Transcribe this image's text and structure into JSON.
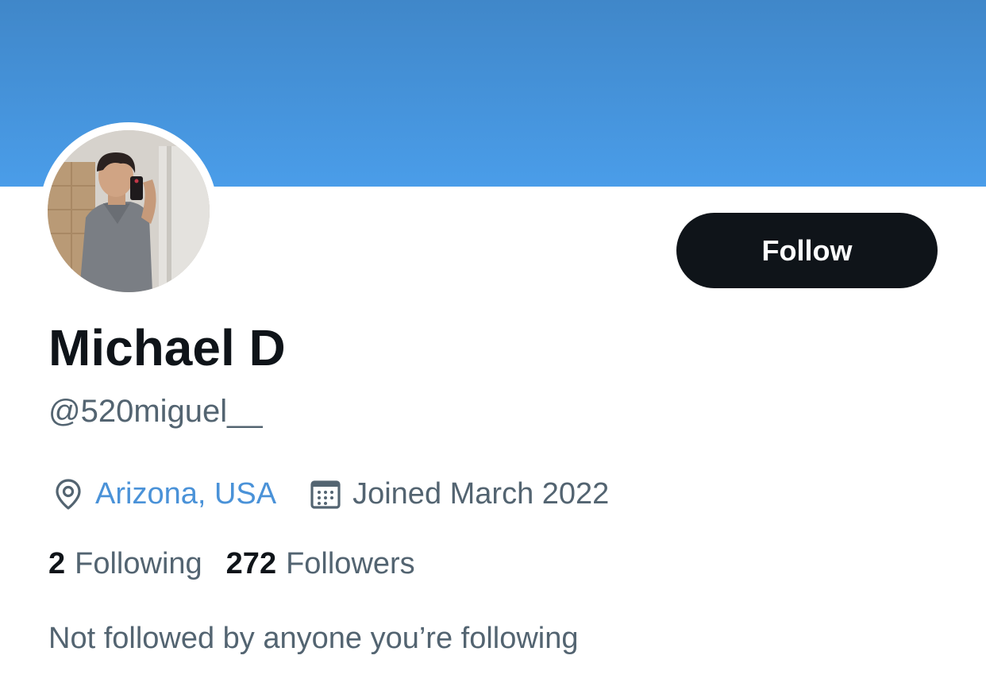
{
  "profile": {
    "banner_color": "#4a9de9",
    "avatar_alt": "profile photo",
    "display_name": "Michael D",
    "handle": "@520miguel__",
    "location": "Arizona, USA",
    "joined": "Joined March 2022",
    "location_icon": "location-pin-icon",
    "joined_icon": "calendar-icon"
  },
  "actions": {
    "follow_label": "Follow"
  },
  "stats": {
    "following_count": "2",
    "following_label": "Following",
    "followers_count": "272",
    "followers_label": "Followers"
  },
  "social_context": {
    "text": "Not followed by anyone you’re following"
  },
  "colors": {
    "text_primary": "#0f1419",
    "text_secondary": "#536471",
    "link": "#4a92d8",
    "button_bg": "#0f1419"
  }
}
